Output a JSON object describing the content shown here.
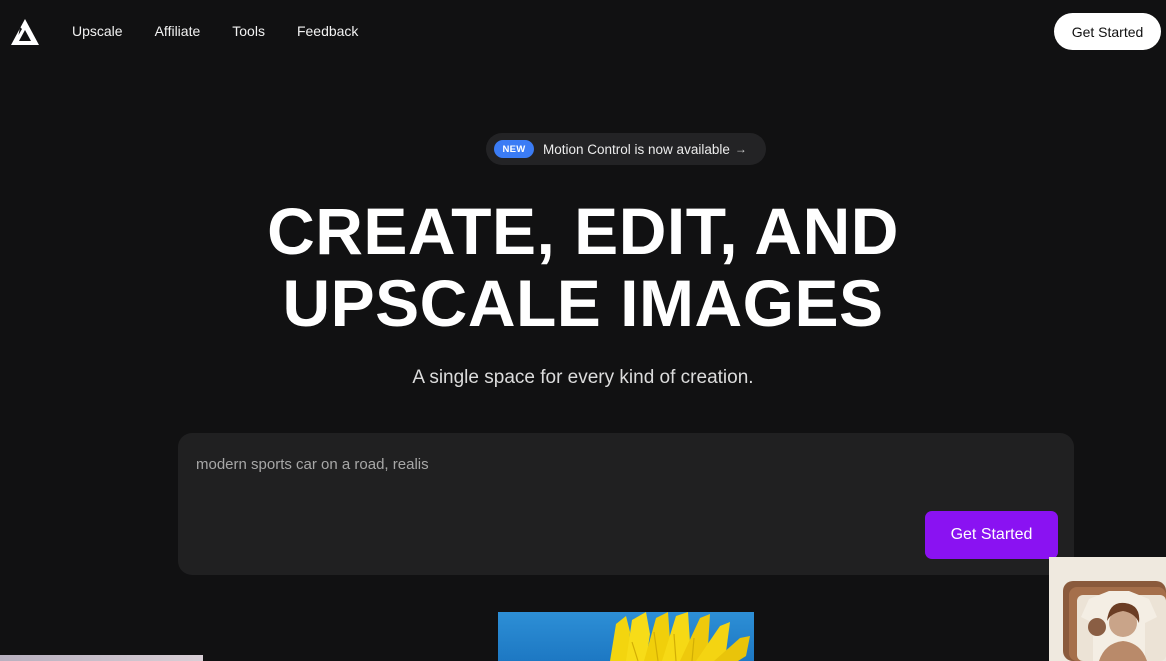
{
  "nav": {
    "logo_name": "mountain-logo",
    "links": [
      "Upscale",
      "Affiliate",
      "Tools",
      "Feedback"
    ],
    "cta_label": "Get Started"
  },
  "announcement": {
    "badge": "NEW",
    "text": "Motion Control is now available",
    "arrow": "→"
  },
  "hero": {
    "title_line1": "CREATE, EDIT, AND",
    "title_line2": "UPSCALE IMAGES",
    "subtitle": "A single space for every kind of creation."
  },
  "prompt": {
    "value": "modern sports car on a road, realis",
    "cta_label": "Get Started"
  },
  "colors": {
    "background": "#111112",
    "accent": "#8a12f2",
    "badge": "#3b7cf5",
    "panel": "#202021"
  }
}
